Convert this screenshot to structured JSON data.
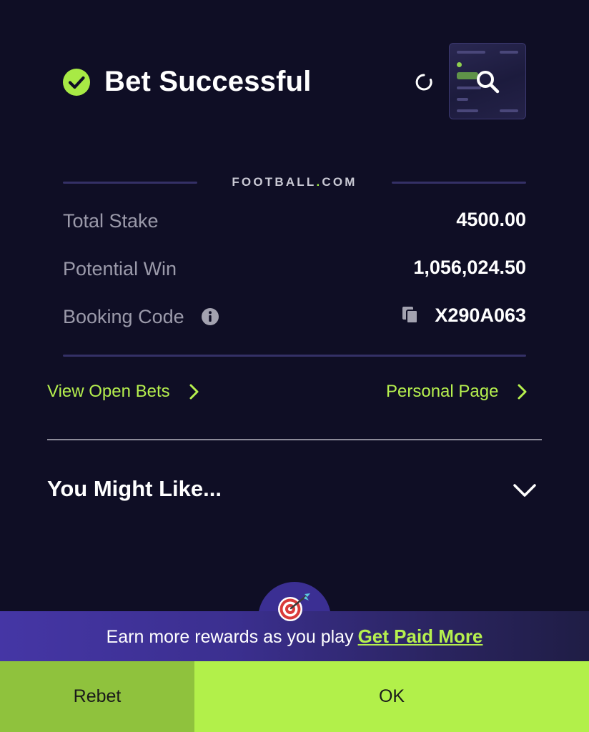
{
  "header": {
    "title": "Bet Successful",
    "check_icon": "check-circle-icon",
    "spinner_icon": "loading-spinner-icon",
    "thumbnail_icon": "search-icon"
  },
  "brand": {
    "name_part1": "FOOTBALL",
    "name_dot": ".",
    "name_part2": "COM"
  },
  "details": {
    "total_stake_label": "Total Stake",
    "total_stake_value": "4500.00",
    "potential_win_label": "Potential Win",
    "potential_win_value": "1,056,024.50",
    "booking_code_label": "Booking Code",
    "booking_code_value": "X290A063"
  },
  "links": {
    "view_open_bets": "View Open Bets",
    "personal_page": "Personal Page"
  },
  "recommendations": {
    "title": "You Might Like..."
  },
  "rewards": {
    "text": "Earn more rewards as you play",
    "link": "Get Paid More"
  },
  "buttons": {
    "rebet": "Rebet",
    "ok": "OK"
  },
  "colors": {
    "background": "#0f0e25",
    "accent_green": "#b2f04a",
    "rebet_green": "#8fc23d",
    "purple": "#3b2f93"
  }
}
